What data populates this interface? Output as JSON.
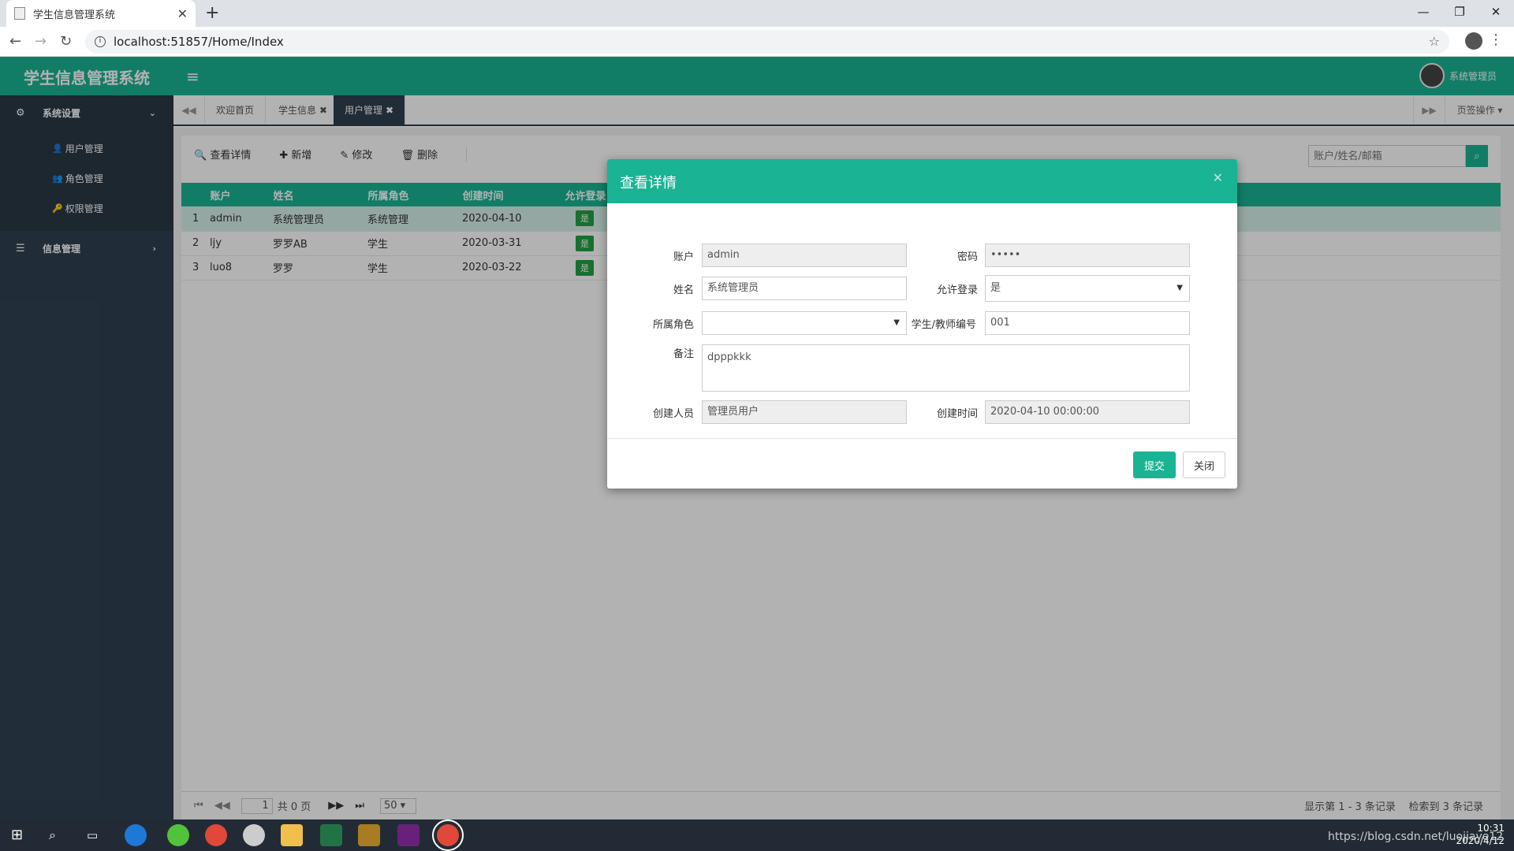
{
  "browser": {
    "tab_title": "学生信息管理系统",
    "url": "localhost:51857/Home/Index"
  },
  "app": {
    "title": "学生信息管理系统",
    "user": "系统管理员"
  },
  "sidebar": {
    "groups": [
      {
        "label": "系统设置",
        "items": [
          "用户管理",
          "角色管理",
          "权限管理"
        ]
      },
      {
        "label": "信息管理",
        "items": []
      }
    ]
  },
  "content_tabs": [
    {
      "label": "欢迎首页",
      "closable": false
    },
    {
      "label": "学生信息",
      "closable": true
    },
    {
      "label": "用户管理",
      "closable": true,
      "active": true
    }
  ],
  "page_op": "页签操作",
  "toolbar": {
    "view": "查看详情",
    "add": "新增",
    "edit": "修改",
    "delete": "删除"
  },
  "search_placeholder": "账户/姓名/邮箱",
  "table": {
    "columns": [
      "账户",
      "姓名",
      "所属角色",
      "创建时间",
      "允许登录"
    ],
    "rows": [
      {
        "no": "1",
        "account": "admin",
        "name": "系统管理员",
        "role": "系统管理",
        "created": "2020-04-10",
        "allow": "是"
      },
      {
        "no": "2",
        "account": "ljy",
        "name": "罗罗AB",
        "role": "学生",
        "created": "2020-03-31",
        "allow": "是"
      },
      {
        "no": "3",
        "account": "luo8",
        "name": "罗罗",
        "role": "学生",
        "created": "2020-03-22",
        "allow": "是"
      }
    ]
  },
  "pager": {
    "page": "1",
    "total_pages": "共 0 页",
    "size": "50",
    "display": "显示第 1 - 3 条记录",
    "found": "检索到 3 条记录"
  },
  "modal": {
    "title": "查看详情",
    "labels": {
      "account": "账户",
      "password": "密码",
      "name": "姓名",
      "allow_login": "允许登录",
      "role": "所属角色",
      "number": "学生/教师编号",
      "remark": "备注",
      "creator": "创建人员",
      "created_time": "创建时间"
    },
    "values": {
      "account": "admin",
      "password": "•••••",
      "name": "系统管理员",
      "allow_login": "是",
      "role": "",
      "number": "001",
      "remark": "dpppkkk",
      "creator": "管理员用户",
      "created_time": "2020-04-10 00:00:00"
    },
    "submit": "提交",
    "close": "关闭"
  },
  "taskbar": {
    "time": "10:31",
    "date": "2020/4/12",
    "watermark": "https://blog.csdn.net/luojiaye12"
  }
}
